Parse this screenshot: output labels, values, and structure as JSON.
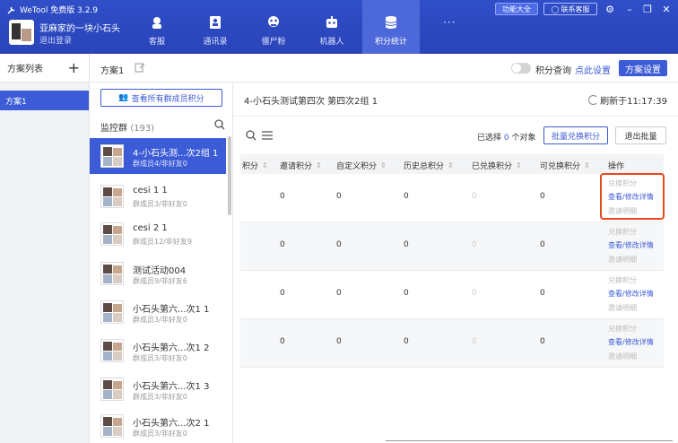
{
  "app": {
    "title": "WeTool 免费版 3.2.9",
    "profile_name": "亚麻家的一块小石头",
    "logout": "退出登录"
  },
  "nav": [
    {
      "label": "客服",
      "icon": "headset-icon"
    },
    {
      "label": "通讯录",
      "icon": "contacts-icon"
    },
    {
      "label": "僵尸粉",
      "icon": "zombie-icon"
    },
    {
      "label": "机器人",
      "icon": "robot-icon"
    },
    {
      "label": "积分统计",
      "icon": "database-icon",
      "active": true
    }
  ],
  "top_right": {
    "more": "···",
    "func_all": "功能大全",
    "contact_service": "联系客服"
  },
  "plan_list": {
    "title": "方案列表",
    "add": "+",
    "items": [
      "方案1"
    ]
  },
  "plan_bar": {
    "plan_name": "方案1",
    "score_query": "积分查询",
    "click_setting": "点此设置",
    "plan_setting": "方案设置"
  },
  "groups": {
    "view_all": "查看所有群成员积分",
    "monitor_label": "监控群",
    "monitor_count": "(193)",
    "items": [
      {
        "name": "4-小石头测...次2组 1",
        "sub": "群成员4/非好友0",
        "active": true
      },
      {
        "name": "cesi 1 1",
        "sub": "群成员3/非好友0"
      },
      {
        "name": "cesi 2 1",
        "sub": "群成员12/非好友9"
      },
      {
        "name": "测试活动004",
        "sub": "群成员9/非好友6"
      },
      {
        "name": "小石头第六...次1 1",
        "sub": "群成员3/非好友0"
      },
      {
        "name": "小石头第六...次1 2",
        "sub": "群成员3/非好友0"
      },
      {
        "name": "小石头第六...次1 3",
        "sub": "群成员3/非好友0"
      },
      {
        "name": "小石头第六...次2 1",
        "sub": "群成员3/非好友0"
      }
    ]
  },
  "main": {
    "title": "4-小石头测试第四次 第四次2组 1",
    "refresh": "刷新于11:17:39",
    "selected_prefix": "已选择",
    "selected_count": "0",
    "selected_suffix": "个对象",
    "batch_exchange": "批量兑换积分",
    "exit_batch": "退出批量"
  },
  "table": {
    "headers": [
      "积分",
      "邀请积分",
      "自定义积分",
      "历史总积分",
      "已兑换积分",
      "可兑换积分",
      "操作"
    ],
    "rows": [
      {
        "invite": "0",
        "custom": "0",
        "history": "0",
        "exchanged": "0",
        "available": "0"
      },
      {
        "invite": "0",
        "custom": "0",
        "history": "0",
        "exchanged": "0",
        "available": "0"
      },
      {
        "invite": "0",
        "custom": "0",
        "history": "0",
        "exchanged": "0",
        "available": "0"
      },
      {
        "invite": "0",
        "custom": "0",
        "history": "0",
        "exchanged": "0",
        "available": "0"
      }
    ],
    "actions": {
      "exchange": "兑换积分",
      "view_edit": "查看/修改详情",
      "invite_detail": "邀请明细"
    }
  },
  "colors": {
    "primary": "#3c5bd6",
    "header_bg": "#2f4ec8",
    "highlight": "#e8471c"
  }
}
